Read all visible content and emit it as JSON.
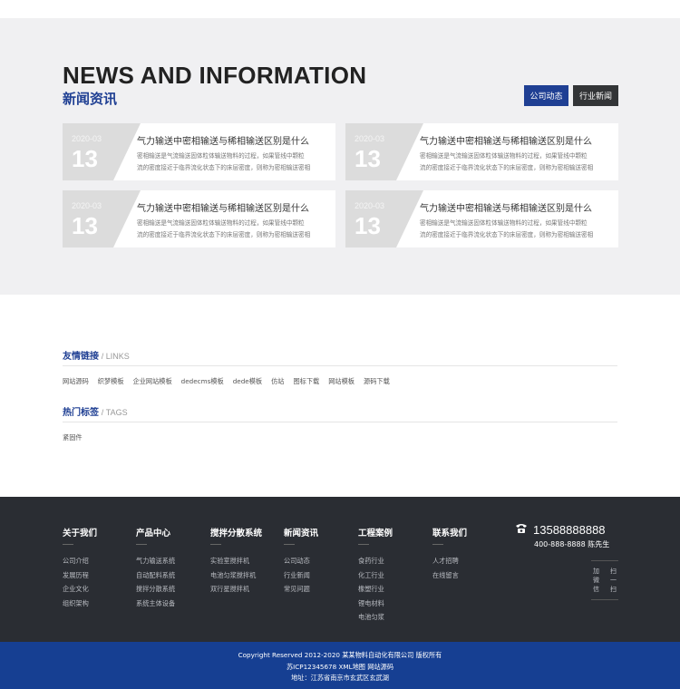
{
  "news": {
    "title_en": "NEWS AND INFORMATION",
    "title_cn": "新闻资讯",
    "tabs": [
      {
        "label": "公司动态",
        "active": true
      },
      {
        "label": "行业新闻",
        "active": false
      }
    ],
    "cards": [
      {
        "month": "2020-03",
        "day": "13",
        "title": "气力输送中密相输送与稀相输送区别是什么",
        "desc_1": "密相输送是气流输送固体粒体输送物料的过程，如果管线中颗粒",
        "desc_2": "流的密度接近于临界流化状态下的床层密度，则称为密相输送密相"
      },
      {
        "month": "2020-03",
        "day": "13",
        "title": "气力输送中密相输送与稀相输送区别是什么",
        "desc_1": "密相输送是气流输送固体粒体输送物料的过程，如果管线中颗粒",
        "desc_2": "流的密度接近于临界流化状态下的床层密度，则称为密相输送密相"
      },
      {
        "month": "2020-03",
        "day": "13",
        "title": "气力输送中密相输送与稀相输送区别是什么",
        "desc_1": "密相输送是气流输送固体粒体输送物料的过程，如果管线中颗粒",
        "desc_2": "流的密度接近于临界流化状态下的床层密度，则称为密相输送密相"
      },
      {
        "month": "2020-03",
        "day": "13",
        "title": "气力输送中密相输送与稀相输送区别是什么",
        "desc_1": "密相输送是气流输送固体粒体输送物料的过程，如果管线中颗粒",
        "desc_2": "流的密度接近于临界流化状态下的床层密度，则称为密相输送密相"
      }
    ]
  },
  "links": {
    "title_cn": "友情链接",
    "title_en": "/ LINKS",
    "items": [
      "网站源码",
      "织梦模板",
      "企业网站模板",
      "dedecms模板",
      "dede模板",
      "仿站",
      "图标下载",
      "网站模板",
      "源码下载"
    ]
  },
  "tags": {
    "title_cn": "热门标签",
    "title_en": "/ TAGS",
    "items": [
      "紧固件"
    ]
  },
  "footer": {
    "columns": [
      {
        "head": "关于我们",
        "items": [
          "公司介绍",
          "发展历程",
          "企业文化",
          "组织架构"
        ]
      },
      {
        "head": "产品中心",
        "items": [
          "气力输送系统",
          "自动配料系统",
          "搅拌分散系统",
          "系统主体设备"
        ]
      },
      {
        "head": "搅拌分散系统",
        "items": [
          "实验室搅拌机",
          "电池匀浆搅拌机",
          "双行星搅拌机"
        ]
      },
      {
        "head": "新闻资讯",
        "items": [
          "公司动态",
          "行业新闻",
          "常见问题"
        ]
      },
      {
        "head": "工程案例",
        "items": [
          "食药行业",
          "化工行业",
          "橡塑行业",
          "锂电材料",
          "电池匀浆"
        ]
      },
      {
        "head": "联系我们",
        "items": [
          "人才招聘",
          "在线留言"
        ]
      }
    ],
    "phone": "13588888888",
    "phone_sub": "400-888-8888 陈先生",
    "qr_left": [
      "加",
      "微",
      "信"
    ],
    "qr_right": [
      "扫",
      "一",
      "扫"
    ]
  },
  "copyright": {
    "line1": "Copyright Reserved 2012-2020 某某物料自动化有限公司 版权所有",
    "line2": "苏ICP12345678 XML地图 网站源码",
    "line3": "地址：江苏省南京市玄武区玄武湖"
  },
  "colors": {
    "brand_blue": "#1f3f93",
    "footer_bg": "#2a2d33",
    "copyright_bg": "#163f92"
  }
}
